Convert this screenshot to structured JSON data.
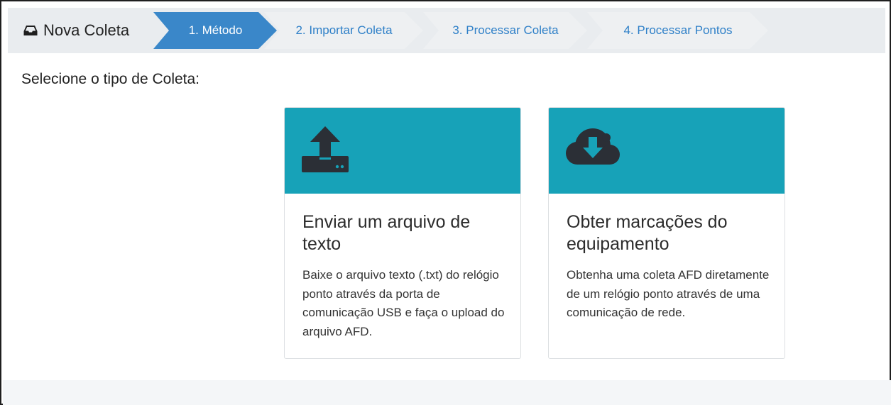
{
  "wizard": {
    "title": "Nova Coleta",
    "title_icon": "inbox-icon",
    "steps": [
      {
        "label": "1. Método",
        "active": true
      },
      {
        "label": "2. Importar Coleta",
        "active": false
      },
      {
        "label": "3. Processar Coleta",
        "active": false
      },
      {
        "label": "4. Processar Pontos",
        "active": false
      }
    ]
  },
  "prompt": "Selecione o tipo de Coleta:",
  "cards": [
    {
      "icon": "upload-icon",
      "title": "Enviar um arquivo de texto",
      "description": "Baixe o arquivo texto (.txt) do relógio ponto através da porta de comunicação USB e faça o upload do arquivo AFD."
    },
    {
      "icon": "cloud-download-icon",
      "title": "Obter marcações do equipamento",
      "description": "Obtenha uma coleta AFD diretamente de um relógio ponto através de uma comunicação de rede."
    }
  ],
  "colors": {
    "active_step": "#3a87c9",
    "step_text": "#2f80c8",
    "card_header": "#17a2b8",
    "icon": "#2b2f36"
  }
}
